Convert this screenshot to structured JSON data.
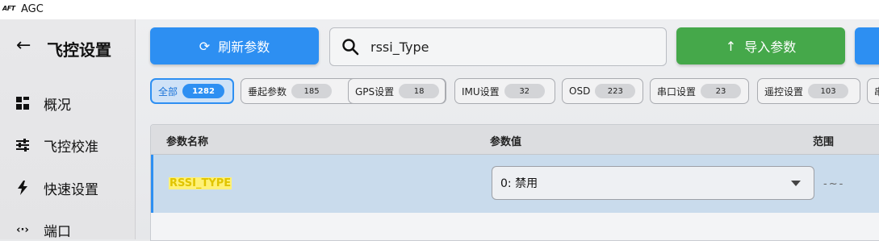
{
  "window": {
    "logo_text": "AFT",
    "title": "AGC"
  },
  "sidebar": {
    "title": "飞控设置",
    "items": [
      {
        "label": "概况",
        "icon": "dashboard-icon"
      },
      {
        "label": "飞控校准",
        "icon": "sliders-icon"
      },
      {
        "label": "快速设置",
        "icon": "lightning-icon"
      },
      {
        "label": "端口",
        "icon": "port-icon"
      }
    ]
  },
  "toolbar": {
    "refresh_label": "刷新参数",
    "search_value": "rssi_Type",
    "import_label": "导入参数"
  },
  "filters": [
    {
      "label": "全部",
      "count": "1282",
      "active": true
    },
    {
      "label": "垂起参数",
      "count": "185"
    },
    {
      "label": "GPS设置",
      "count": "18"
    },
    {
      "label": "IMU设置",
      "count": "32"
    },
    {
      "label": "OSD",
      "count": "223"
    },
    {
      "label": "串口设置",
      "count": "23"
    },
    {
      "label": "遥控设置",
      "count": "103"
    },
    {
      "label": "串",
      "count": ""
    }
  ],
  "table": {
    "headers": {
      "name": "参数名称",
      "value": "参数值",
      "range": "范围"
    },
    "rows": [
      {
        "name": "RSSI_TYPE",
        "value": "0: 禁用",
        "range": "-~-"
      }
    ]
  },
  "colors": {
    "primary": "#2d8ff2",
    "success": "#45a84a",
    "highlight": "#fff176"
  }
}
